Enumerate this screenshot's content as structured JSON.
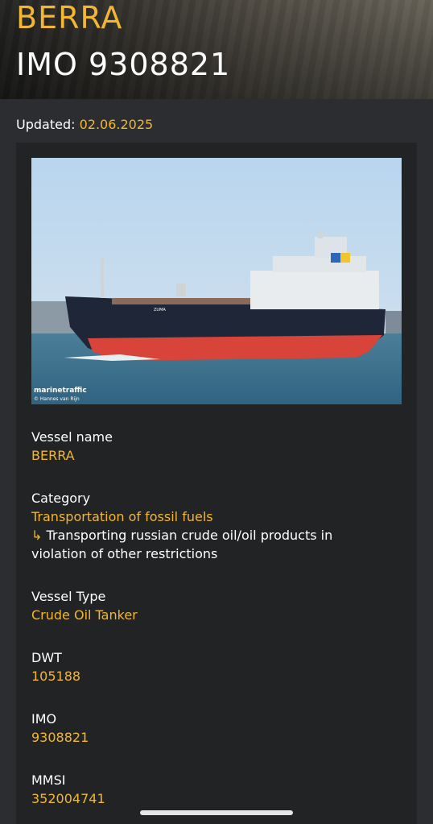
{
  "header": {
    "vessel_name": "BERRA",
    "imo_line": "IMO 9308821"
  },
  "updated": {
    "label": "Updated:",
    "date": "02.06.2025"
  },
  "photo": {
    "watermark": "marinetraffic",
    "credit": "© Hannes van Rijn",
    "ship_hull_text": "ZUMA"
  },
  "fields": {
    "vessel_name": {
      "label": "Vessel name",
      "value": "BERRA"
    },
    "category": {
      "label": "Category",
      "value": "Transportation of fossil fuels",
      "sub_arrow": "↳",
      "sub": "Transporting russian crude oil/oil products in violation of other restrictions"
    },
    "vessel_type": {
      "label": "Vessel Type",
      "value": "Crude Oil Tanker"
    },
    "dwt": {
      "label": "DWT",
      "value": "105188"
    },
    "imo": {
      "label": "IMO",
      "value": "9308821"
    },
    "mmsi": {
      "label": "MMSI",
      "value": "352004741"
    }
  },
  "colors": {
    "accent": "#f2b632",
    "background": "#2b2d30",
    "card": "#222325",
    "text": "#ffffff"
  }
}
